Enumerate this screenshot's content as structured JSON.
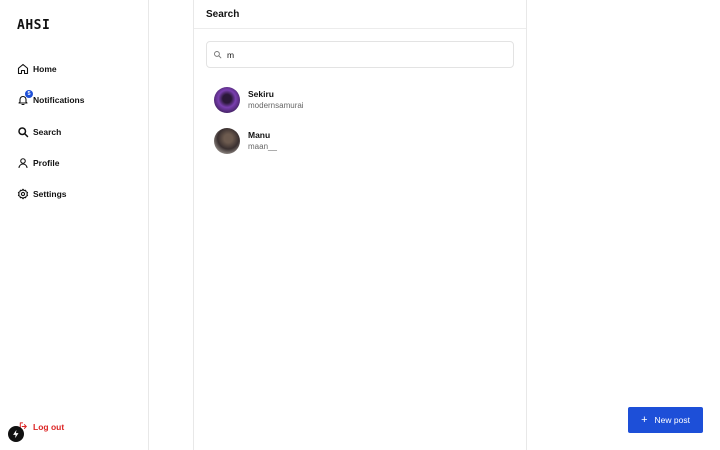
{
  "app": {
    "logo": "AHSI"
  },
  "sidebar": {
    "items": [
      {
        "label": "Home",
        "icon": "home-icon"
      },
      {
        "label": "Notifications",
        "icon": "bell-icon",
        "badge": "5"
      },
      {
        "label": "Search",
        "icon": "search-icon"
      },
      {
        "label": "Profile",
        "icon": "user-icon"
      },
      {
        "label": "Settings",
        "icon": "gear-icon"
      }
    ],
    "logout_label": "Log out"
  },
  "search": {
    "title": "Search",
    "query": "m",
    "results": [
      {
        "name": "Sekiru",
        "handle": "modernsamurai"
      },
      {
        "name": "Manu",
        "handle": "maan__"
      }
    ]
  },
  "actions": {
    "new_post_label": "New post",
    "new_post_icon": "plus-icon"
  },
  "colors": {
    "accent": "#1d4fd8",
    "danger": "#dc2626"
  }
}
